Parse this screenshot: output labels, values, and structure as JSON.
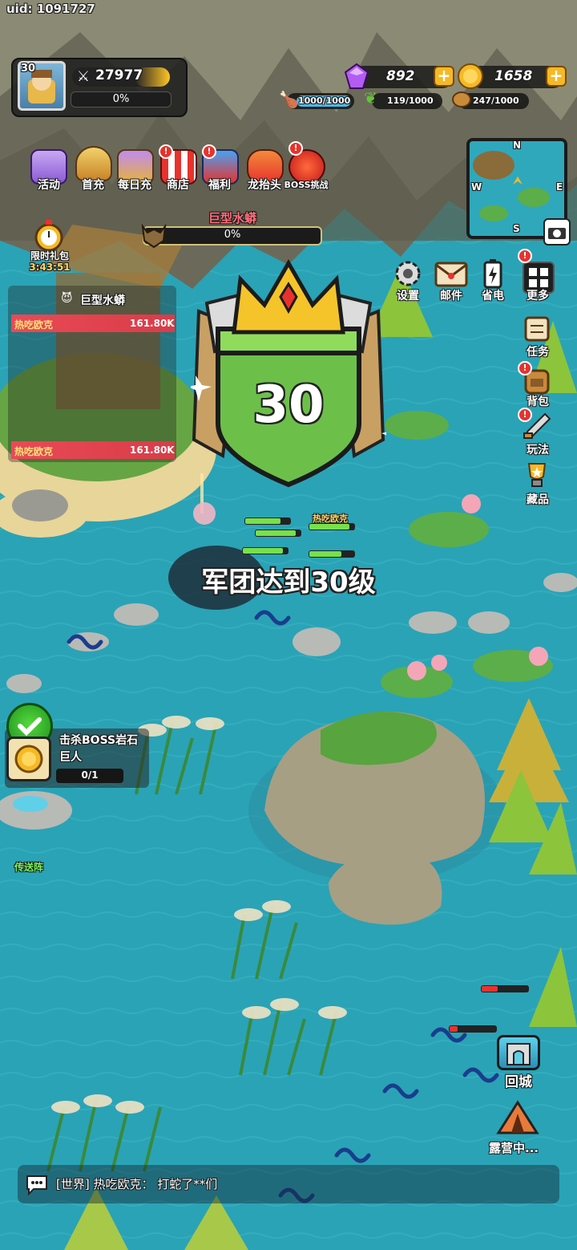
{
  "uid": "uid: 1091727",
  "player": {
    "level": "30",
    "power": "27977",
    "exp_percent": "0%"
  },
  "resources": {
    "gems": "892",
    "gold": "1658",
    "meat": "1000/1000",
    "wood": "119/1000",
    "stone": "247/1000"
  },
  "top_menu": [
    {
      "label": "活动",
      "icon": "treasure-chest-icon",
      "badge": false
    },
    {
      "label": "首充",
      "icon": "king-icon",
      "badge": false
    },
    {
      "label": "每日充",
      "icon": "gem-cart-icon",
      "badge": false
    },
    {
      "label": "商店",
      "icon": "shop-icon",
      "badge": true
    },
    {
      "label": "福利",
      "icon": "gift-icon",
      "badge": true
    },
    {
      "label": "龙抬头",
      "icon": "dragon-icon",
      "badge": false
    },
    {
      "label": "BOSS挑战",
      "icon": "demon-icon",
      "badge": true
    }
  ],
  "limited_gift": {
    "label": "限时礼包",
    "timer": "3:43:51"
  },
  "boss": {
    "name": "巨型水蟒",
    "hp_percent": "0%",
    "panel_title": "巨型水蟒",
    "damage_rows": [
      {
        "player": "热吃欧克",
        "damage": "161.80K"
      },
      {
        "player": "热吃欧克",
        "damage": "161.80K"
      }
    ]
  },
  "right_top_buttons": [
    {
      "label": "设置",
      "icon": "gear-icon",
      "badge": false
    },
    {
      "label": "邮件",
      "icon": "mail-icon",
      "badge": false
    },
    {
      "label": "省电",
      "icon": "battery-icon",
      "badge": false
    },
    {
      "label": "更多",
      "icon": "grid-icon",
      "badge": true
    }
  ],
  "right_side_buttons": [
    {
      "label": "任务",
      "icon": "scroll-icon",
      "badge": false
    },
    {
      "label": "背包",
      "icon": "backpack-icon",
      "badge": true
    },
    {
      "label": "玩法",
      "icon": "sword-icon",
      "badge": true
    },
    {
      "label": "藏品",
      "icon": "trophy-icon",
      "badge": false
    }
  ],
  "minimap": {
    "n": "N",
    "w": "W",
    "e": "E",
    "s": "S"
  },
  "levelup": {
    "badge_level": "30",
    "message": "军团达到30级"
  },
  "unit_name": "热吃欧克",
  "quest": {
    "title": "击杀BOSS岩石巨人",
    "progress": "0/1"
  },
  "teleport_label": "传送阵",
  "return_city": "回城",
  "camp": "露营中...",
  "chat": {
    "message": "[世界] 热吃欧克： 打蛇了**们"
  },
  "colors": {
    "water": "#2aa6b8",
    "gold": "#f5b924",
    "green_shield": "#6cc04a",
    "damage_red": "#e84a56"
  }
}
